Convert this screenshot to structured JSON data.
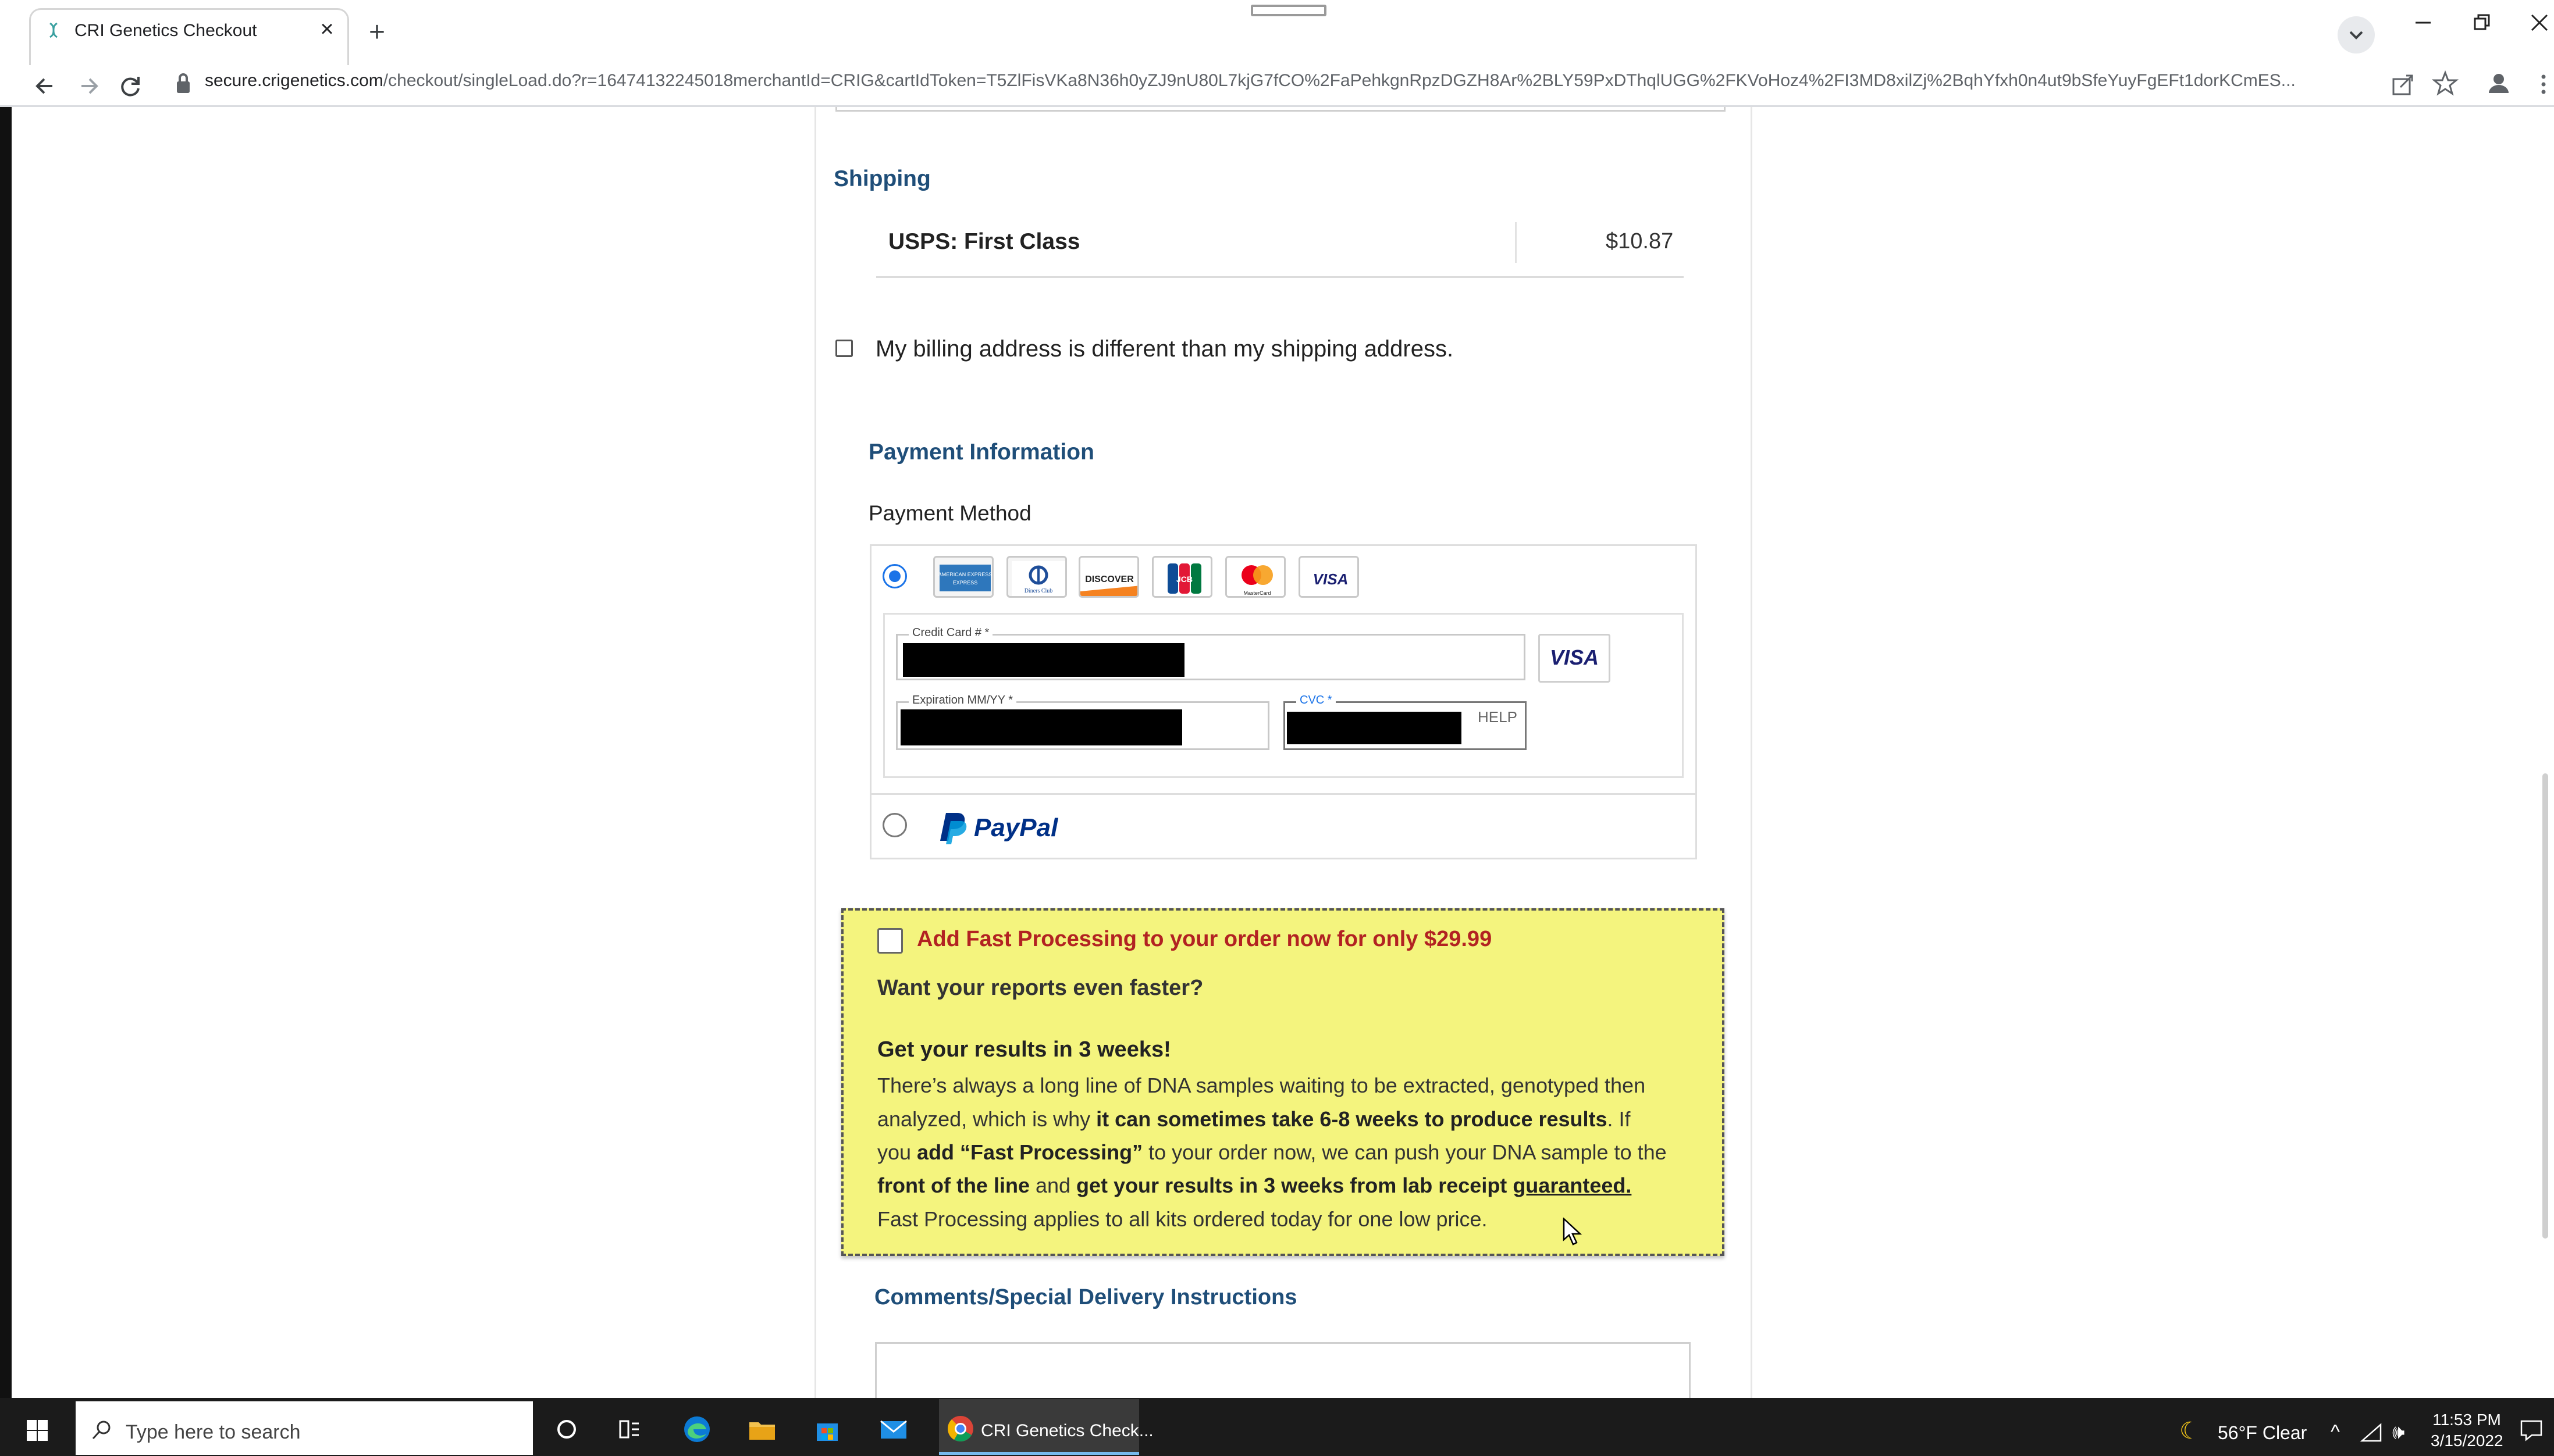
{
  "browser": {
    "tab_title": "CRI Genetics Checkout",
    "url_host": "secure.crigenetics.com",
    "url_path": "/checkout/singleLoad.do?r=16474132245018merchantId=CRIG&cartIdToken=T5ZlFisVKa8N36h0yZJ9nU80L7kjG7fCO%2FaPehkgnRpzDGZH8Ar%2BLY59PxDThqlUGG%2FKVoHoz4%2FI3MD8xilZj%2BqhYfxh0n4ut9bSfeYuyFgEFt1dorKCmES..."
  },
  "shipping": {
    "title": "Shipping",
    "method": "USPS: First Class",
    "price": "$10.87"
  },
  "billing": {
    "checkbox_label": "My billing address is different than my shipping address."
  },
  "payment": {
    "title": "Payment Information",
    "method_label": "Payment Method",
    "cards": [
      "AMERICAN EXPRESS",
      "Diners Club",
      "DISCOVER",
      "JCB",
      "MasterCard",
      "VISA"
    ],
    "card_number_label": "Credit Card # *",
    "expiration_label": "Expiration MM/YY *",
    "cvc_label": "CVC *",
    "cvc_help": "HELP",
    "detected_brand": "VISA",
    "paypal": "PayPal",
    "selected": "credit-card"
  },
  "fast_processing": {
    "offer": "Add Fast Processing to your order now for only $29.99",
    "question": "Want your reports even faster?",
    "headline": "Get your results in 3 weeks!",
    "l1": "There’s always a long line of DNA samples waiting to be extracted, genotyped then",
    "l2a": "analyzed, which is why ",
    "l2b": "it can sometimes take 6-8 weeks to produce results",
    "l2c": ". If",
    "l3a": "you ",
    "l3b": "add “Fast Processing”",
    "l3c": " to your order now, we can push your DNA sample to the",
    "l4a": "front of the line",
    "l4b": " and ",
    "l4c": "get your results in 3 weeks from lab receipt ",
    "l4d": "guaranteed.",
    "l5": "Fast Processing applies to all kits ordered today for one low price."
  },
  "comments": {
    "title": "Comments/Special Delivery Instructions"
  },
  "taskbar": {
    "search_placeholder": "Type here to search",
    "chrome_label": "CRI Genetics Check...",
    "weather": "56°F  Clear",
    "time": "11:53 PM",
    "date": "3/15/2022"
  },
  "colors": {
    "section_title": "#1f4e79",
    "offer_red": "#b22222",
    "fast_box": "#f4f47e",
    "selected_radio": "#1a73e8"
  }
}
